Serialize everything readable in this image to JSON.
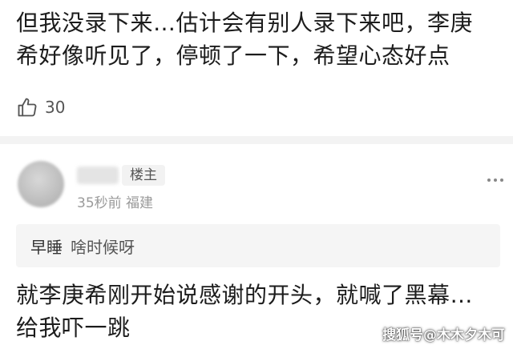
{
  "top_comment": {
    "lines": [
      "但我没录下来…估计会有别人录下来吧，李庚",
      "希好像听见了，停顿了一下，希望心态好点"
    ],
    "like_icon": "thumbs-up-icon",
    "like_count": "30"
  },
  "reply": {
    "badge": "楼主",
    "meta": "35秒前 福建",
    "more_icon": "more-dots-icon",
    "quote_user": "早睡",
    "quote_text": "啥时候呀",
    "lines": [
      "就李庚希刚开始说感谢的开头，就喊了黑幕…",
      "给我吓一跳"
    ]
  },
  "watermark": "搜狐号@木木夕木可"
}
